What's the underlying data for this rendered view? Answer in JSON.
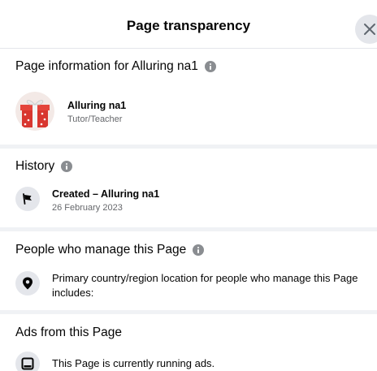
{
  "dialog": {
    "title": "Page transparency",
    "close_icon": "close-icon"
  },
  "page_info": {
    "heading": "Page information for Alluring na1",
    "page_name": "Alluring na1",
    "category": "Tutor/Teacher",
    "avatar_icon": "gift-box-image"
  },
  "history": {
    "heading": "History",
    "event_label": "Created – Alluring na1",
    "event_date": "26 February 2023",
    "event_icon": "flag-icon"
  },
  "managers": {
    "heading": "People who manage this Page",
    "location_text": "Primary country/region location for people who manage this Page includes:",
    "location_icon": "location-pin-icon"
  },
  "ads": {
    "heading": "Ads from this Page",
    "status_text": "This Page is currently running ads.",
    "ads_icon": "ad-screen-icon"
  },
  "colors": {
    "info_icon": "#8a8d91",
    "divider": "#f0f2f5",
    "secondary_text": "#65676b"
  }
}
